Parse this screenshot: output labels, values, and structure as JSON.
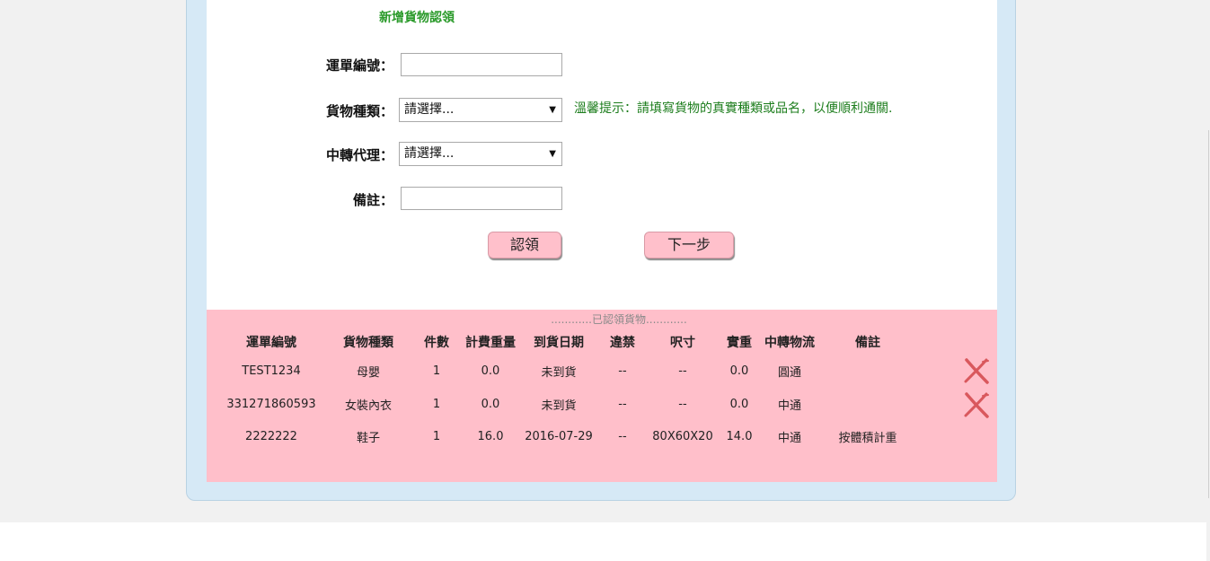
{
  "form": {
    "title": "新增貨物認領",
    "fields": {
      "waybill_label": "運單編號：",
      "waybill_value": "",
      "goods_type_label": "貨物種類：",
      "goods_type_selected": "請選擇...",
      "transfer_agent_label": "中轉代理：",
      "transfer_agent_selected": "請選擇...",
      "remarks_label": "備註：",
      "remarks_value": ""
    },
    "hint": "溫馨提示：請填寫貨物的真實種類或品名，以便順利通關.",
    "buttons": {
      "claim": "認領",
      "next": "下一步"
    }
  },
  "claimed": {
    "title": "............已認領貨物............",
    "columns": [
      "運單編號",
      "貨物種類",
      "件數",
      "計費重量",
      "到貨日期",
      "違禁",
      "呎寸",
      "實重",
      "中轉物流",
      "備註"
    ],
    "rows": [
      {
        "waybill": "TEST1234",
        "type": "母嬰",
        "pieces": "1",
        "charge_weight": "0.0",
        "arrival": "未到貨",
        "prohibited": "--",
        "dimensions": "--",
        "actual_weight": "0.0",
        "logistics": "圓通",
        "remarks": "",
        "deletable": true
      },
      {
        "waybill": "331271860593",
        "type": "女裝內衣",
        "pieces": "1",
        "charge_weight": "0.0",
        "arrival": "未到貨",
        "prohibited": "--",
        "dimensions": "--",
        "actual_weight": "0.0",
        "logistics": "中通",
        "remarks": "",
        "deletable": true
      },
      {
        "waybill": "2222222",
        "type": "鞋子",
        "pieces": "1",
        "charge_weight": "16.0",
        "arrival": "2016-07-29",
        "prohibited": "--",
        "dimensions": "80X60X20",
        "actual_weight": "14.0",
        "logistics": "中通",
        "remarks": "按體積計重",
        "deletable": false
      }
    ]
  },
  "colors": {
    "title_green": "#2a9a2a",
    "hint_green": "#1c7d1c",
    "pink": "#ffbfca",
    "panel_blue": "#d6e9f6",
    "delete_red": "#d9585d"
  },
  "icons": {
    "delete": "delete-x-icon",
    "select_arrow": "triangle-down-icon"
  }
}
